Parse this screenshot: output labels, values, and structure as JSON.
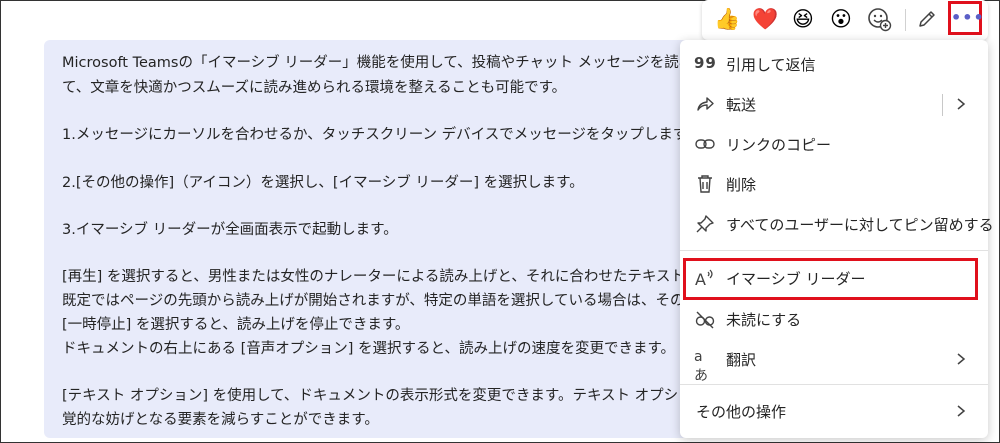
{
  "message": {
    "lines": [
      "Microsoft Teamsの「イマーシブ リーダー」機能を使用して、投稿やチャット メッセージを読み上げる",
      "て、文章を快適かつスムーズに読み進められる環境を整えることも可能です。",
      "1.メッセージにカーソルを合わせるか、タッチスクリーン デバイスでメッセージをタップします。",
      "2.[その他の操作]（アイコン）を選択し、[イマーシブ リーダー] を選択します。",
      "3.イマーシブ リーダーが全画面表示で起動します。",
      "[再生] を選択すると、男性または女性のナレーターによる読み上げと、それに合わせたテキストのハ",
      "既定ではページの先頭から読み上げが開始されますが、特定の単語を選択している場合は、その",
      "[一時停止] を選択すると、読み上げを停止できます。",
      "ドキュメントの右上にある [音声オプション] を選択すると、読み上げの速度を変更できます。",
      "[テキスト オプション] を使用して、ドキュメントの表示形式を変更できます。テキスト オプションを活用",
      "覚的な妨げとなる要素を減らすことができます。"
    ]
  },
  "reactions": {
    "emojis": [
      "👍",
      "❤️",
      "😆",
      "😮"
    ],
    "more_label": "•••"
  },
  "menu": {
    "items": [
      {
        "label": "引用して返信",
        "icon": "quote-icon"
      },
      {
        "label": "転送",
        "icon": "forward-icon"
      },
      {
        "label": "リンクのコピー",
        "icon": "link-icon"
      },
      {
        "label": "削除",
        "icon": "trash-icon"
      },
      {
        "label": "すべてのユーザーに対してピン留めする",
        "icon": "pin-icon"
      },
      {
        "label": "イマーシブ リーダー",
        "icon": "immersive-reader-icon"
      },
      {
        "label": "未読にする",
        "icon": "unread-icon"
      },
      {
        "label": "翻訳",
        "icon": "translate-icon"
      },
      {
        "label": "その他の操作",
        "icon": ""
      }
    ],
    "quote_glyph": "99",
    "translate_glyph": "aあ"
  },
  "colors": {
    "highlight": "#e0101c",
    "message_bg": "#e8ebfa",
    "accent": "#5b5fc7"
  }
}
